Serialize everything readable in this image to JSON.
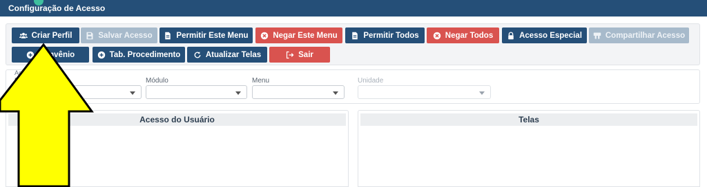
{
  "window": {
    "title": "Configuração de Acesso"
  },
  "toolbar": {
    "row1": [
      {
        "label": "Criar Perfil",
        "icon": "users-icon",
        "style": "dark"
      },
      {
        "label": "Salvar Acesso",
        "icon": "save-icon",
        "style": "disabled"
      },
      {
        "label": "Permitir Este Menu",
        "icon": "document-icon",
        "style": "dark"
      },
      {
        "label": "Negar Este Menu",
        "icon": "times-circle-icon",
        "style": "red"
      },
      {
        "label": "Permitir Todos",
        "icon": "document-icon",
        "style": "dark"
      },
      {
        "label": "Negar Todos",
        "icon": "times-circle-icon",
        "style": "red"
      },
      {
        "label": "Acesso Especial",
        "icon": "lock-icon",
        "style": "dark"
      },
      {
        "label": "Compartilhar Acesso",
        "icon": "share-icon",
        "style": "disabled"
      }
    ],
    "row2": [
      {
        "label": "Convênio",
        "icon": "plus-circle-icon",
        "style": "dark"
      },
      {
        "label": "Tab. Procedimento",
        "icon": "plus-circle-icon",
        "style": "dark"
      },
      {
        "label": "Atualizar Telas",
        "icon": "refresh-icon",
        "style": "dark"
      },
      {
        "label": "Sair",
        "icon": "sign-out-icon",
        "style": "red"
      }
    ]
  },
  "filters": {
    "legend": "Ace",
    "fields": [
      {
        "label": "U",
        "value": "",
        "enabled": true
      },
      {
        "label": "Módulo",
        "value": "",
        "enabled": true
      },
      {
        "label": "Menu",
        "value": "",
        "enabled": true
      },
      {
        "label": "Unidade",
        "value": "",
        "enabled": false
      }
    ]
  },
  "panels": {
    "left_title": "Acesso do Usuário",
    "right_title": "Telas"
  },
  "colors": {
    "primary": "#254f78",
    "danger": "#d9534f",
    "disabled": "#a7bacb",
    "annotation_arrow": "#ffff00"
  },
  "overlay": {
    "icon": "up-arrow-annotation-icon"
  }
}
